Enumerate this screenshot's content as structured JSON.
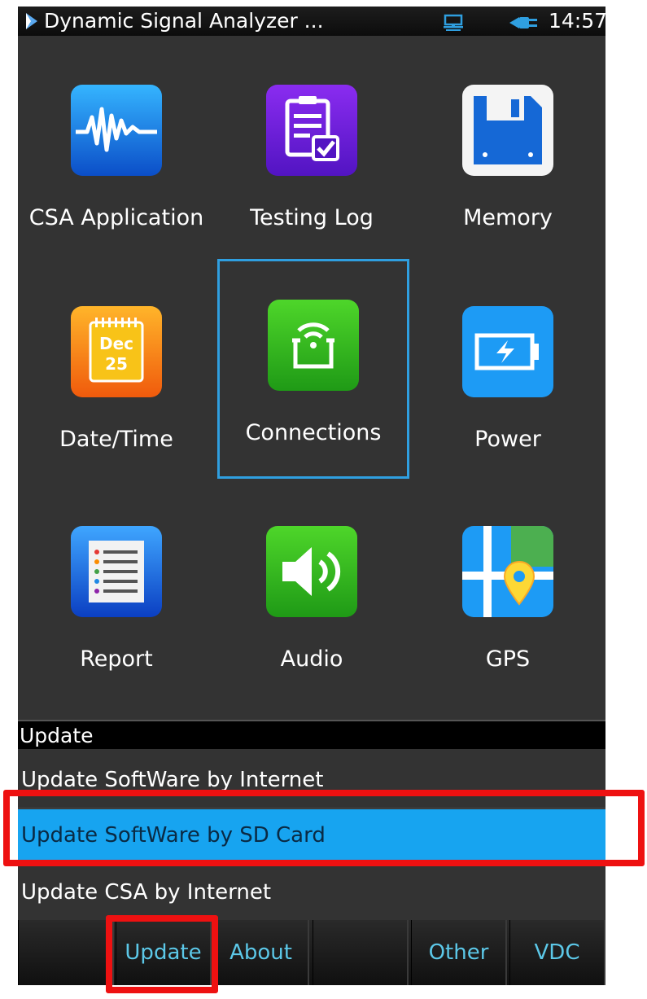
{
  "status_bar": {
    "title": "Dynamic Signal Analyzer ...",
    "time": "14:57",
    "network_icon": "network-icon",
    "power_icon": "plug-icon"
  },
  "apps": [
    {
      "label": "CSA Application",
      "icon": "waveform-icon"
    },
    {
      "label": "Testing Log",
      "icon": "clipboard-check-icon"
    },
    {
      "label": "Memory",
      "icon": "floppy-disk-icon"
    },
    {
      "label": "Date/Time",
      "icon": "calendar-icon",
      "icon_text": [
        "Dec",
        "25"
      ]
    },
    {
      "label": "Connections",
      "icon": "wireless-icon",
      "selected": true
    },
    {
      "label": "Power",
      "icon": "battery-icon"
    },
    {
      "label": "Report",
      "icon": "list-icon"
    },
    {
      "label": "Audio",
      "icon": "speaker-icon"
    },
    {
      "label": "GPS",
      "icon": "map-pin-icon"
    }
  ],
  "update_panel": {
    "header": "Update",
    "items": [
      {
        "label": "Update SoftWare by Internet"
      },
      {
        "label": "Update SoftWare by SD Card",
        "selected": true
      },
      {
        "label": "Update CSA by Internet"
      }
    ]
  },
  "tabs": [
    {
      "label": ""
    },
    {
      "label": "Update",
      "active": true
    },
    {
      "label": "About"
    },
    {
      "label": ""
    },
    {
      "label": "Other"
    },
    {
      "label": "VDC"
    }
  ],
  "colors": {
    "background": "#333333",
    "selection_blue": "#17a4f0",
    "tab_text": "#5cc8e8",
    "highlight_red": "#ee1111"
  }
}
